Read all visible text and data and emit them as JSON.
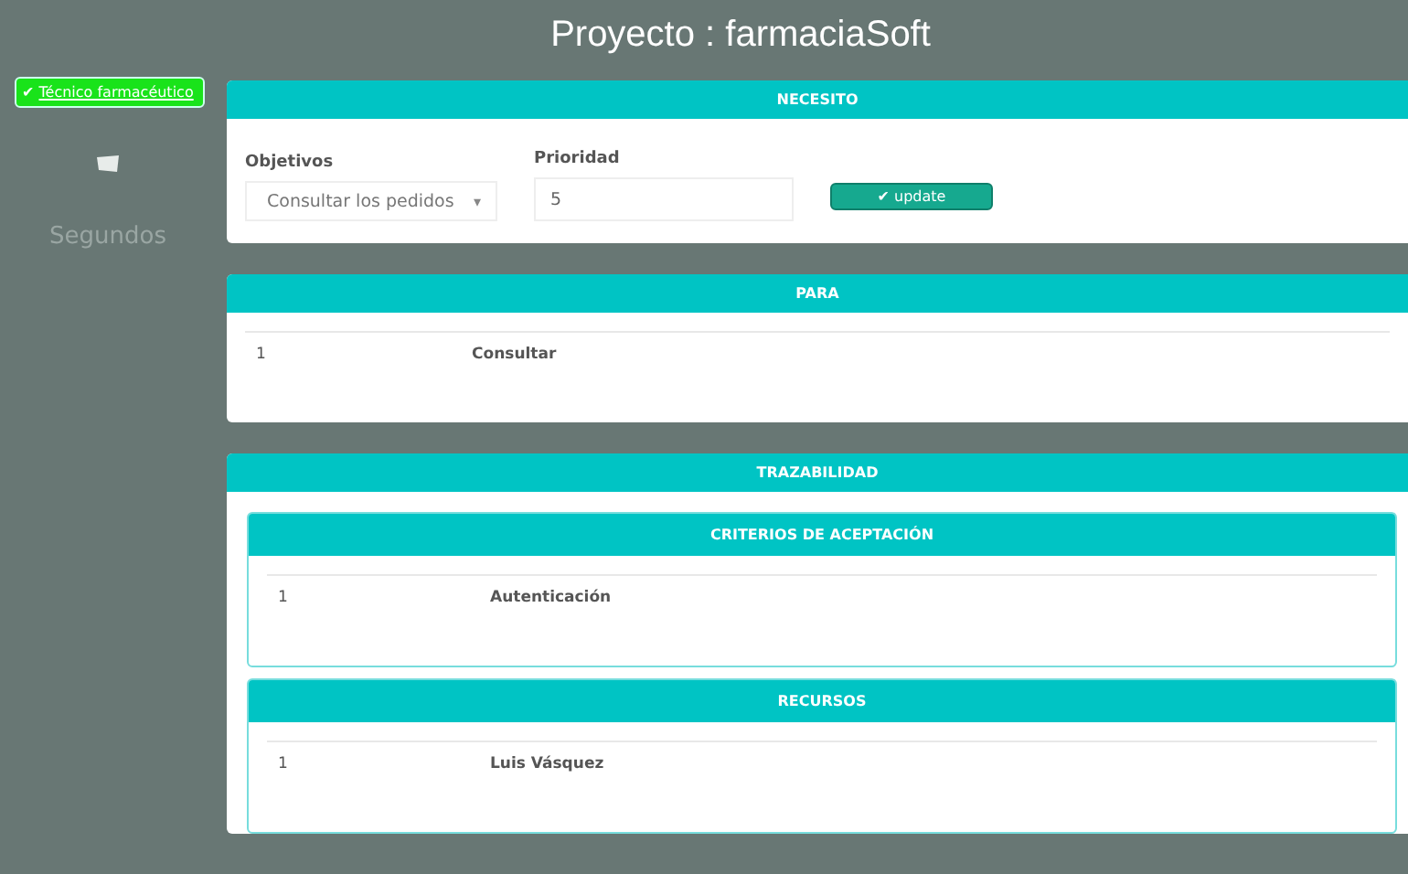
{
  "header": {
    "title": "Proyecto : farmaciaSoft"
  },
  "sidebar": {
    "role_badge": {
      "check": "✔",
      "label": "Técnico farmacéutico"
    },
    "timer_label": "Segundos"
  },
  "necesito": {
    "title": "NECESITO",
    "objetivos": {
      "label": "Objetivos",
      "value": "Consultar los pedidos",
      "caret": "▾"
    },
    "prioridad": {
      "label": "Prioridad",
      "value": "5"
    },
    "button": {
      "check": "✔",
      "label": "update"
    }
  },
  "para": {
    "title": "PARA",
    "rows": [
      {
        "index": "1",
        "text": "Consultar"
      }
    ]
  },
  "trazabilidad": {
    "title": "TRAZABILIDAD",
    "sections": [
      {
        "title": "CRITERIOS DE ACEPTACIÓN",
        "rows": [
          {
            "index": "1",
            "text": "Autenticación"
          }
        ]
      },
      {
        "title": "RECURSOS",
        "rows": [
          {
            "index": "1",
            "text": "Luis Vásquez"
          }
        ]
      }
    ]
  }
}
